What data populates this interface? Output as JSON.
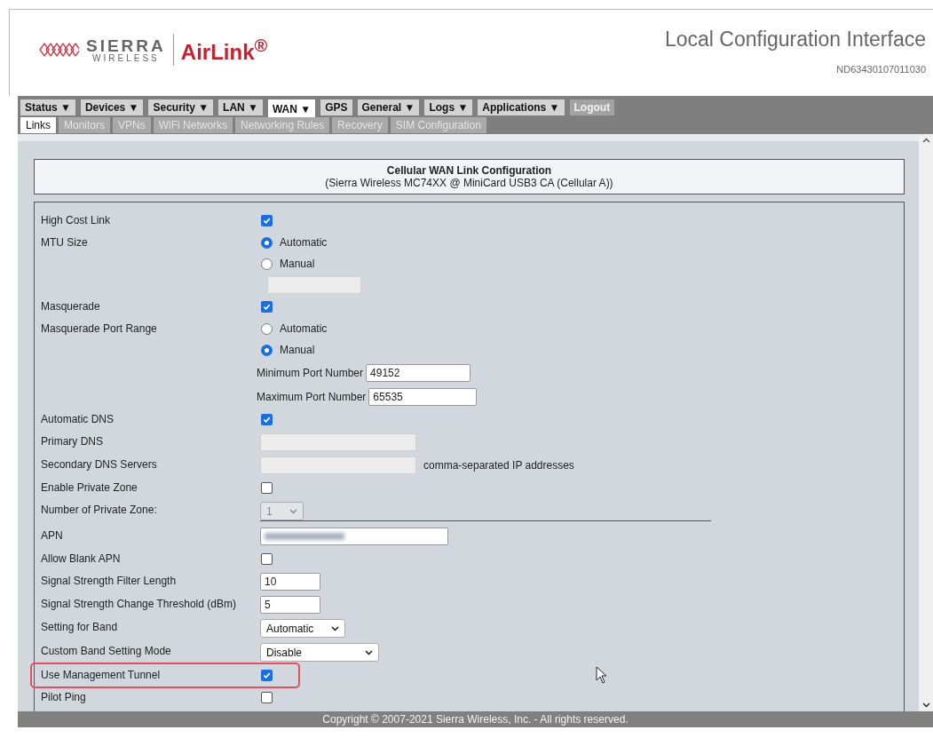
{
  "header": {
    "logo": {
      "brand": "SIERRA",
      "sub": "WIRELESS",
      "product": "AirLink$^{®}$"
    },
    "title": "Local Configuration Interface",
    "serial": "ND63430107011030"
  },
  "menu": [
    {
      "label": "Status ▼",
      "kind": "menu",
      "selected": false
    },
    {
      "label": "Devices ▼",
      "kind": "menu",
      "selected": false
    },
    {
      "label": "Security ▼",
      "kind": "menu",
      "selected": false
    },
    {
      "label": "LAN ▼",
      "kind": "menu",
      "selected": false
    },
    {
      "label": "WAN ▼",
      "kind": "menu",
      "selected": true
    },
    {
      "label": "GPS",
      "kind": "menu",
      "selected": false
    },
    {
      "label": "General ▼",
      "kind": "menu",
      "selected": false
    },
    {
      "label": "Logs ▼",
      "kind": "menu",
      "selected": false
    },
    {
      "label": "Applications ▼",
      "kind": "menu",
      "selected": false
    },
    {
      "label": "Logout",
      "kind": "action",
      "selected": false
    }
  ],
  "submenu": [
    {
      "label": "Links",
      "selected": true
    },
    {
      "label": "Monitors",
      "selected": false
    },
    {
      "label": "VPNs",
      "selected": false
    },
    {
      "label": "WiFi Networks",
      "selected": false
    },
    {
      "label": "Networking Rules",
      "selected": false
    },
    {
      "label": "Recovery",
      "selected": false
    },
    {
      "label": "SIM Configuration",
      "selected": false
    }
  ],
  "panel": {
    "title": "Cellular WAN Link Configuration",
    "subtitle": "(Sierra Wireless MC74XX @ MiniCard USB3 CA (Cellular A))"
  },
  "rows": [
    {
      "kind": "checkbox",
      "label": "High Cost Link",
      "checked": true,
      "highlighted": false
    },
    {
      "kind": "radios",
      "label": "MTU Size",
      "highlighted": false,
      "options": [
        {
          "label": "Automatic",
          "selected": true
        },
        {
          "label": "Manual",
          "selected": false
        }
      ],
      "blank_field": true
    },
    {
      "kind": "checkbox",
      "label": "Masquerade",
      "checked": true,
      "highlighted": false
    },
    {
      "kind": "radios",
      "label": "Masquerade Port Range",
      "highlighted": false,
      "options": [
        {
          "label": "Automatic",
          "selected": false
        },
        {
          "label": "Manual",
          "selected": true
        }
      ],
      "inputs": [
        {
          "label": "Minimum Port Number",
          "value": "49152"
        },
        {
          "label": "Maximum Port Number",
          "value": "65535"
        }
      ]
    },
    {
      "kind": "checkbox",
      "label": "Automatic DNS",
      "checked": true,
      "highlighted": false
    },
    {
      "kind": "field",
      "label": "Primary DNS",
      "disabled": true,
      "highlighted": false
    },
    {
      "kind": "field",
      "label": "Secondary DNS Servers",
      "disabled": true,
      "note": "comma-separated IP addresses",
      "highlighted": false
    },
    {
      "kind": "checkbox",
      "label": "Enable Private Zone",
      "checked": false,
      "highlighted": false
    },
    {
      "kind": "short-select",
      "label": "Number of Private Zone:",
      "value": "1",
      "disabled": true,
      "highlighted": false
    },
    {
      "kind": "divider"
    },
    {
      "kind": "long-field",
      "label": "APN",
      "disabled": false,
      "redacted": true,
      "highlighted": false
    },
    {
      "kind": "checkbox",
      "label": "Allow Blank APN",
      "checked": false,
      "highlighted": false
    },
    {
      "kind": "short-field",
      "label": "Signal Strength Filter Length",
      "value": "10",
      "disabled": false,
      "highlighted": false
    },
    {
      "kind": "short-field",
      "label": "Signal Strength Change Threshold (dBm)",
      "value": "5",
      "disabled": false,
      "highlighted": false
    },
    {
      "kind": "select",
      "label": "Setting for Band",
      "value": "Automatic",
      "disabled": false,
      "highlighted": false
    },
    {
      "kind": "long-select",
      "label": "Custom Band Setting Mode",
      "value": "Disable",
      "disabled": false,
      "highlighted": false
    },
    {
      "kind": "checkbox",
      "label": "Use Management Tunnel",
      "checked": true,
      "highlighted": true
    },
    {
      "kind": "checkbox",
      "label": "Pilot Ping",
      "checked": false,
      "highlighted": false
    }
  ],
  "footer": "Copyright © 2007-2021 Sierra Wireless, Inc. - All rights reserved."
}
